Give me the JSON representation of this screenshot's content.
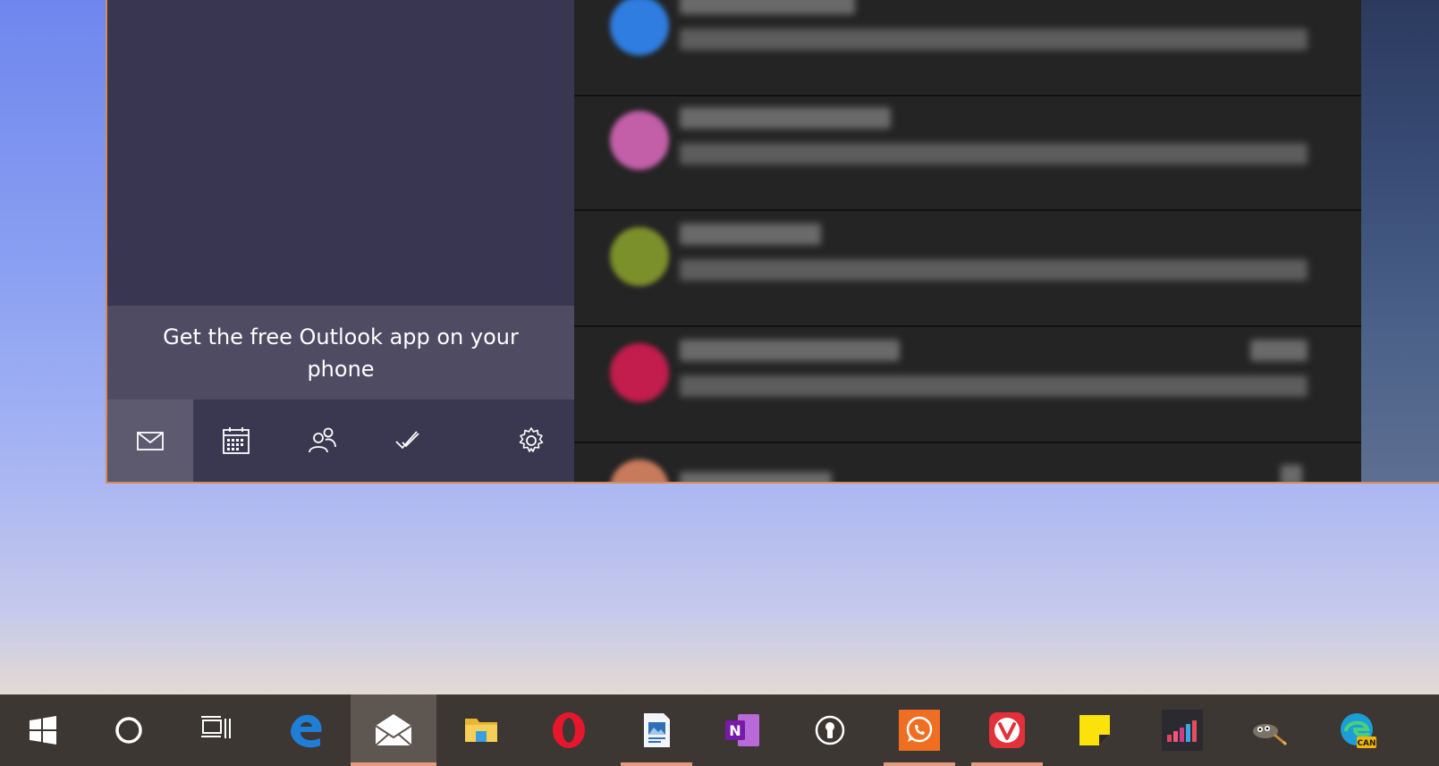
{
  "mail": {
    "promo_text": "Get the free Outlook app on your phone",
    "nav": [
      {
        "name": "mail-icon",
        "active": true
      },
      {
        "name": "calendar-icon",
        "active": false
      },
      {
        "name": "people-icon",
        "active": false
      },
      {
        "name": "todo-icon",
        "active": false
      },
      {
        "name": "settings-icon",
        "active": false
      }
    ],
    "messages": [
      {
        "avatar_color": "#2f7de0"
      },
      {
        "avatar_color": "#c25fa8"
      },
      {
        "avatar_color": "#7b8f2a"
      },
      {
        "avatar_color": "#c21d4c"
      },
      {
        "avatar_color": "#c87a5c"
      }
    ]
  },
  "taskbar": {
    "items": [
      {
        "name": "windows-start-icon",
        "active": false,
        "running": false
      },
      {
        "name": "cortana-search-icon",
        "active": false,
        "running": false
      },
      {
        "name": "task-view-icon",
        "active": false,
        "running": false
      },
      {
        "name": "edge-icon",
        "active": false,
        "running": false
      },
      {
        "name": "mail-app-icon",
        "active": true,
        "running": true
      },
      {
        "name": "file-explorer-icon",
        "active": false,
        "running": false
      },
      {
        "name": "opera-icon",
        "active": false,
        "running": false
      },
      {
        "name": "image-viewer-icon",
        "active": false,
        "running": true
      },
      {
        "name": "onenote-icon",
        "active": false,
        "running": false
      },
      {
        "name": "password-manager-icon",
        "active": false,
        "running": false
      },
      {
        "name": "whatsapp-icon",
        "active": false,
        "running": true
      },
      {
        "name": "vivaldi-icon",
        "active": false,
        "running": true
      },
      {
        "name": "sticky-notes-icon",
        "active": false,
        "running": false
      },
      {
        "name": "deezer-icon",
        "active": false,
        "running": false
      },
      {
        "name": "gimp-icon",
        "active": false,
        "running": false
      },
      {
        "name": "edge-canary-icon",
        "active": false,
        "running": false
      }
    ],
    "edge_canary_badge": "CAN"
  }
}
